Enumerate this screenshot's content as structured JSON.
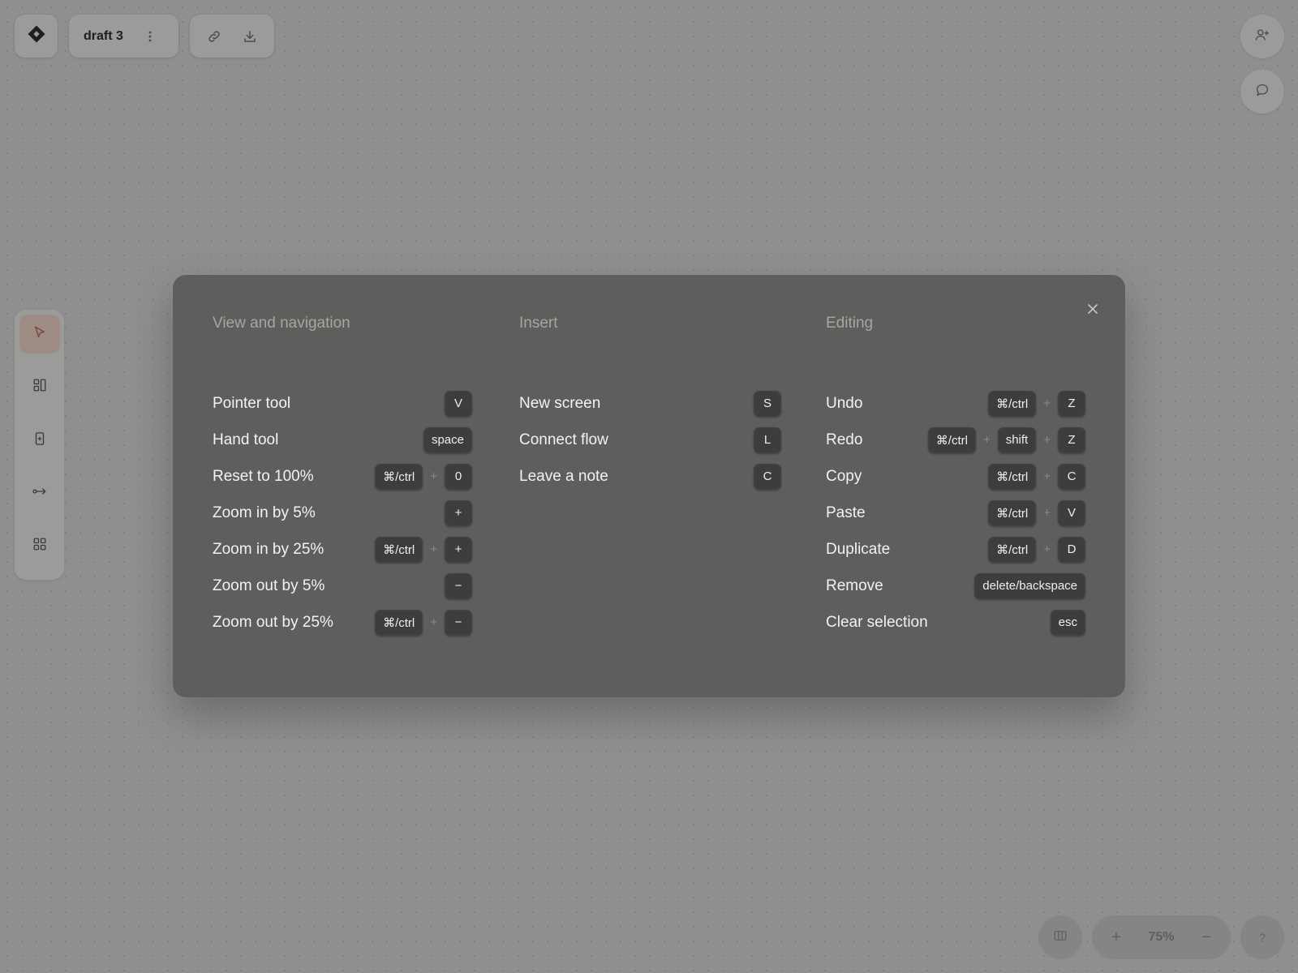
{
  "toolbar": {
    "doc_name": "draft 3"
  },
  "zoom": {
    "in_label": "+",
    "value": "75%",
    "out_label": "−"
  },
  "help_label": "?",
  "shortcuts": {
    "view": {
      "title": "View and navigation",
      "rows": [
        {
          "label": "Pointer tool",
          "keys": [
            "V"
          ]
        },
        {
          "label": "Hand tool",
          "keys": [
            "space"
          ]
        },
        {
          "label": "Reset to 100%",
          "keys": [
            "⌘/ctrl",
            "0"
          ]
        },
        {
          "label": "Zoom in by 5%",
          "keys": [
            "+"
          ]
        },
        {
          "label": "Zoom in by 25%",
          "keys": [
            "⌘/ctrl",
            "+"
          ]
        },
        {
          "label": "Zoom out by 5%",
          "keys": [
            "−"
          ]
        },
        {
          "label": "Zoom out by 25%",
          "keys": [
            "⌘/ctrl",
            "−"
          ]
        }
      ]
    },
    "insert": {
      "title": "Insert",
      "rows": [
        {
          "label": "New screen",
          "keys": [
            "S"
          ]
        },
        {
          "label": "Connect flow",
          "keys": [
            "L"
          ]
        },
        {
          "label": "Leave a note",
          "keys": [
            "C"
          ]
        }
      ]
    },
    "editing": {
      "title": "Editing",
      "rows": [
        {
          "label": "Undo",
          "keys": [
            "⌘/ctrl",
            "Z"
          ]
        },
        {
          "label": "Redo",
          "keys": [
            "⌘/ctrl",
            "shift",
            "Z"
          ]
        },
        {
          "label": "Copy",
          "keys": [
            "⌘/ctrl",
            "C"
          ]
        },
        {
          "label": "Paste",
          "keys": [
            "⌘/ctrl",
            "V"
          ]
        },
        {
          "label": "Duplicate",
          "keys": [
            "⌘/ctrl",
            "D"
          ]
        },
        {
          "label": "Remove",
          "keys": [
            "delete/backspace"
          ]
        },
        {
          "label": "Clear selection",
          "keys": [
            "esc"
          ]
        }
      ]
    },
    "key_separator": "+"
  },
  "icons": {
    "logo": "diamond-logo-icon",
    "more": "more-vertical-icon",
    "link": "link-icon",
    "download": "download-icon",
    "invite": "user-plus-icon",
    "comments": "chat-bubble-icon",
    "pointer": "pointer-icon",
    "layout": "layout-icon",
    "screen": "phone-screen-icon",
    "connect": "connect-flow-icon",
    "components": "grid-icon",
    "panel": "panel-columns-icon",
    "close": "close-icon"
  },
  "colors": {
    "canvas": "#8f8f8d",
    "modal": "#5f5e5c",
    "key": "#3e3d3c",
    "active_tool": "#9d8b84",
    "pointer_accent": "#7a4a3a"
  }
}
